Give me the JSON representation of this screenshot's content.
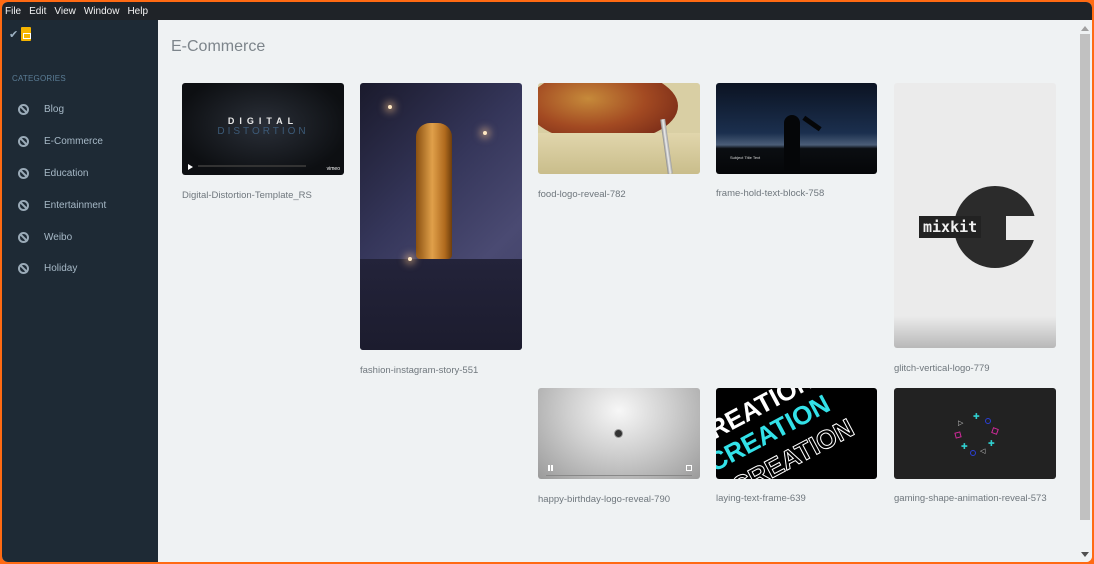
{
  "menu": [
    "File",
    "Edit",
    "View",
    "Window",
    "Help"
  ],
  "sidebar": {
    "categories_title": "CATEGORIES",
    "items": [
      {
        "label": "Blog",
        "icon": "ban-icon"
      },
      {
        "label": "E-Commerce",
        "icon": "ban-icon"
      },
      {
        "label": "Education",
        "icon": "ban-icon"
      },
      {
        "label": "Entertainment",
        "icon": "ban-icon"
      },
      {
        "label": "Weibo",
        "icon": "ban-icon"
      },
      {
        "label": "Holiday",
        "icon": "ban-icon"
      }
    ]
  },
  "main": {
    "title": "E-Commerce",
    "items": [
      {
        "name": "Digital-Distortion-Template_RS",
        "thumb_text_1": "DIGITAL",
        "thumb_text_2": "DISTORTION",
        "player_brand": "vimeo"
      },
      {
        "name": "fashion-instagram-story-551"
      },
      {
        "name": "food-logo-reveal-782"
      },
      {
        "name": "frame-hold-text-block-758",
        "thumb_text": "Subject Title Text"
      },
      {
        "name": "glitch-vertical-logo-779",
        "thumb_text": "mixkit"
      },
      {
        "name": "happy-birthday-logo-reveal-790"
      },
      {
        "name": "laying-text-frame-639",
        "thumb_text": "CREATION"
      },
      {
        "name": "gaming-shape-animation-reveal-573"
      }
    ]
  }
}
